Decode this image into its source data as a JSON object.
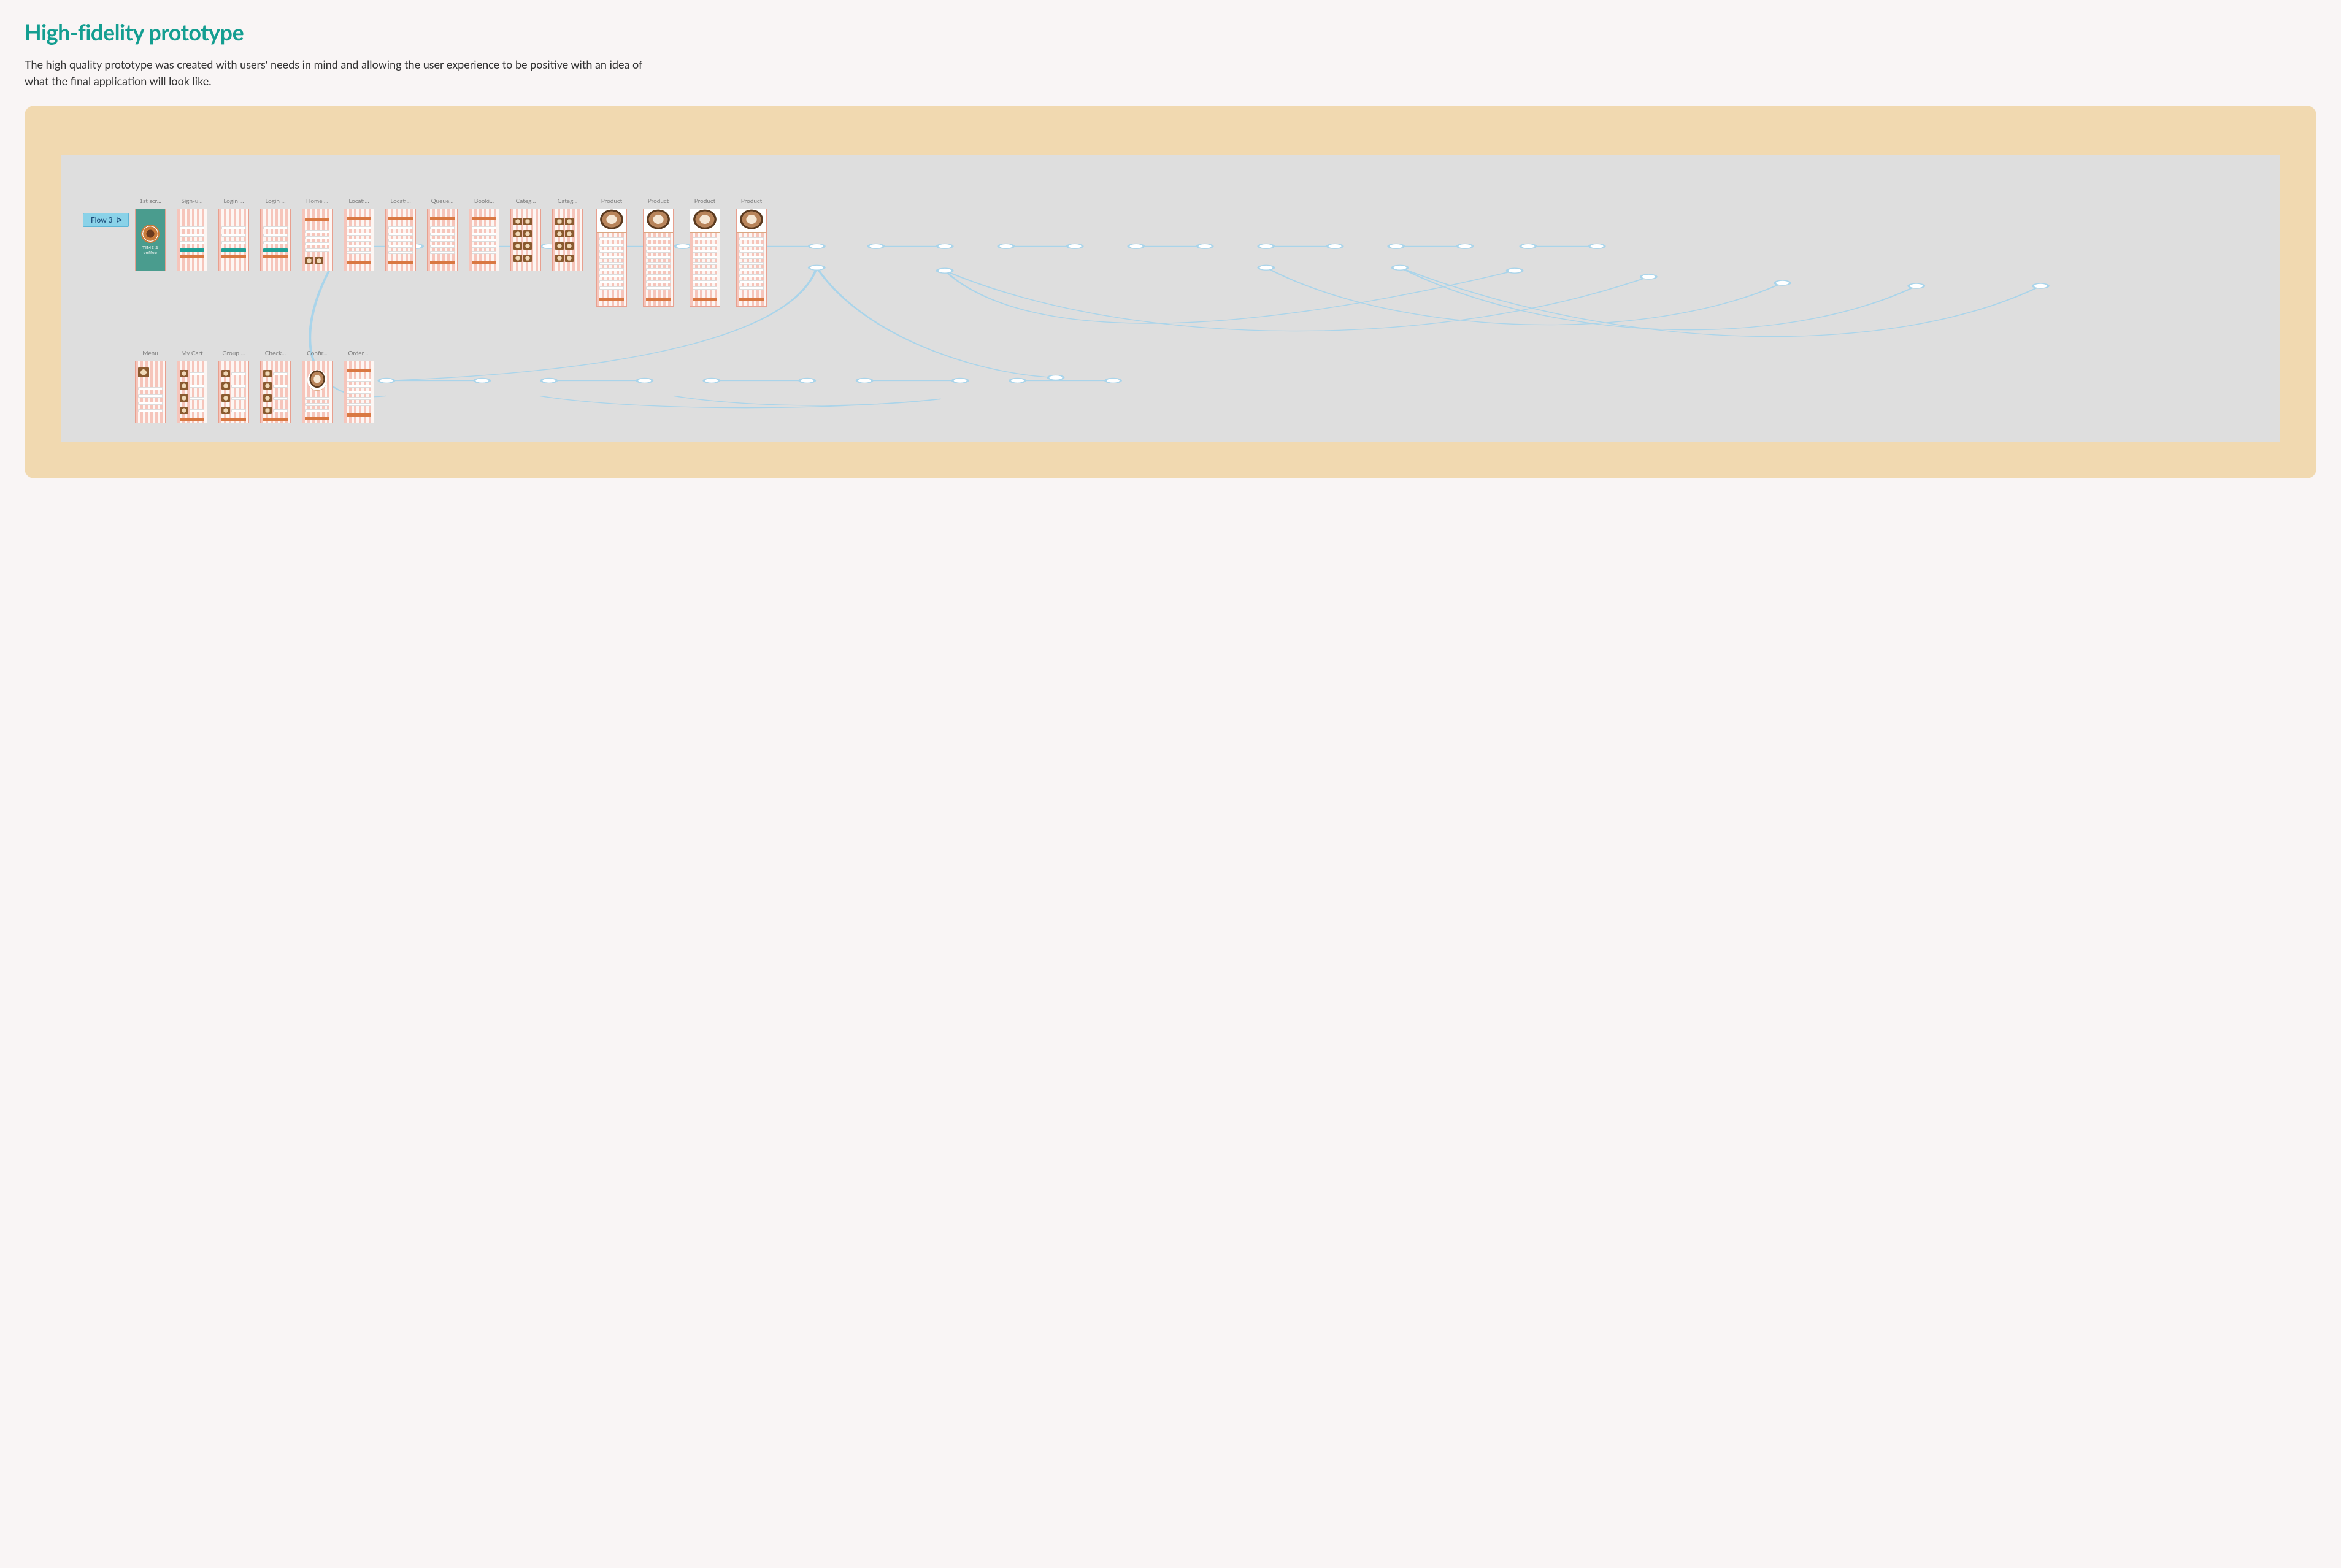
{
  "header": {
    "title": "High-fidelity prototype",
    "description": "The high quality prototype was created with users' needs in mind and allowing the user experience to be positive with an idea of what the final application will look like."
  },
  "flow_badge": "Flow 3",
  "splash": {
    "line1": "TIME 2",
    "line2": "coffee"
  },
  "row1_screens": [
    {
      "label": "1st scr...",
      "variant": "splash"
    },
    {
      "label": "Sign-u...",
      "variant": "form"
    },
    {
      "label": "Login ...",
      "variant": "form"
    },
    {
      "label": "Login ...",
      "variant": "form"
    },
    {
      "label": "Home ...",
      "variant": "home"
    },
    {
      "label": "Locati...",
      "variant": "list"
    },
    {
      "label": "Locati...",
      "variant": "list"
    },
    {
      "label": "Queue...",
      "variant": "list"
    },
    {
      "label": "Booki...",
      "variant": "list"
    },
    {
      "label": "Categ...",
      "variant": "thumbs"
    },
    {
      "label": "Categ...",
      "variant": "thumbs"
    },
    {
      "label": "Product",
      "variant": "product"
    },
    {
      "label": "Product",
      "variant": "product"
    },
    {
      "label": "Product",
      "variant": "product"
    },
    {
      "label": "Product",
      "variant": "product"
    }
  ],
  "row2_screens": [
    {
      "label": "Menu",
      "variant": "menu"
    },
    {
      "label": "My Cart",
      "variant": "cart"
    },
    {
      "label": "Group ...",
      "variant": "cart"
    },
    {
      "label": "Check...",
      "variant": "cart"
    },
    {
      "label": "Confir...",
      "variant": "confirm"
    },
    {
      "label": "Order ...",
      "variant": "list"
    }
  ]
}
